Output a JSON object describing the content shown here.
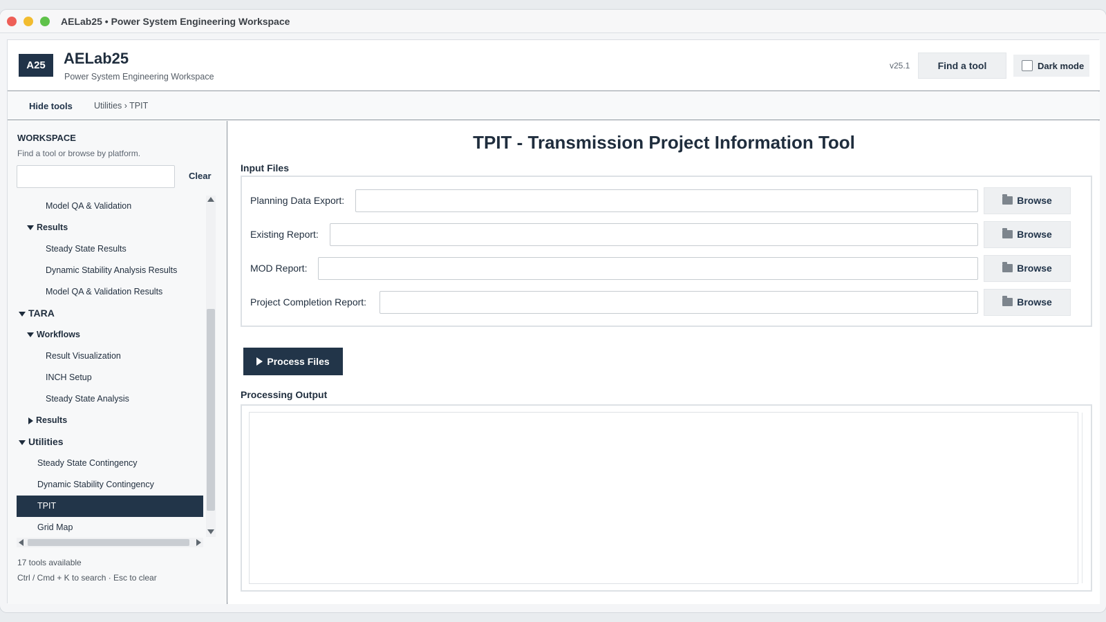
{
  "window": {
    "title": "AELab25 • Power System Engineering Workspace"
  },
  "header": {
    "logo": "A25",
    "app_name": "AELab25",
    "app_subtitle": "Power System Engineering Workspace",
    "version": "v25.1",
    "find_tool_label": "Find a tool",
    "dark_mode_label": "Dark mode",
    "dark_mode_checked": false
  },
  "toolbar": {
    "hide_tools_label": "Hide tools",
    "breadcrumb": "Utilities › TPIT"
  },
  "sidebar": {
    "title": "WORKSPACE",
    "subtitle": "Find a tool or browse by platform.",
    "search_value": "",
    "clear_label": "Clear",
    "tree": [
      {
        "label": "Model QA & Validation",
        "level": 2,
        "type": "leaf"
      },
      {
        "label": "Results",
        "level": 1,
        "type": "group",
        "expanded": true
      },
      {
        "label": "Steady State Results",
        "level": 2,
        "type": "leaf"
      },
      {
        "label": "Dynamic Stability Analysis Results",
        "level": 2,
        "type": "leaf"
      },
      {
        "label": "Model QA & Validation Results",
        "level": 2,
        "type": "leaf"
      },
      {
        "label": "TARA",
        "level": 0,
        "type": "group",
        "expanded": true
      },
      {
        "label": "Workflows",
        "level": 1,
        "type": "group",
        "expanded": true
      },
      {
        "label": "Result Visualization",
        "level": 2,
        "type": "leaf"
      },
      {
        "label": "INCH Setup",
        "level": 2,
        "type": "leaf"
      },
      {
        "label": "Steady State Analysis",
        "level": 2,
        "type": "leaf"
      },
      {
        "label": "Results",
        "level": 1,
        "type": "group",
        "expanded": false
      },
      {
        "label": "Utilities",
        "level": 0,
        "type": "group",
        "expanded": true
      },
      {
        "label": "Steady State Contingency",
        "level": 1,
        "type": "leaf"
      },
      {
        "label": "Dynamic Stability Contingency",
        "level": 1,
        "type": "leaf"
      },
      {
        "label": "TPIT",
        "level": 1,
        "type": "leaf",
        "selected": true
      },
      {
        "label": "Grid Map",
        "level": 1,
        "type": "leaf"
      }
    ],
    "tools_count": "17 tools available",
    "shortcut_hint": "Ctrl / Cmd + K to search · Esc to clear"
  },
  "main": {
    "title": "TPIT - Transmission Project Information Tool",
    "input_section_label": "Input Files",
    "fields": [
      {
        "label": "Planning Data Export:",
        "value": "",
        "browse_label": "Browse"
      },
      {
        "label": "Existing Report:",
        "value": "",
        "browse_label": "Browse"
      },
      {
        "label": "MOD Report:",
        "value": "",
        "browse_label": "Browse"
      },
      {
        "label": "Project Completion Report:",
        "value": "",
        "browse_label": "Browse"
      }
    ],
    "process_label": "Process Files",
    "output_section_label": "Processing Output",
    "output_text": ""
  },
  "colors": {
    "accent": "#223549",
    "selected_bg": "#223549",
    "panel_border": "#dde1e5"
  },
  "icons": [
    "folder-icon",
    "play-icon",
    "expand-triangle-icon",
    "collapse-triangle-icon"
  ]
}
